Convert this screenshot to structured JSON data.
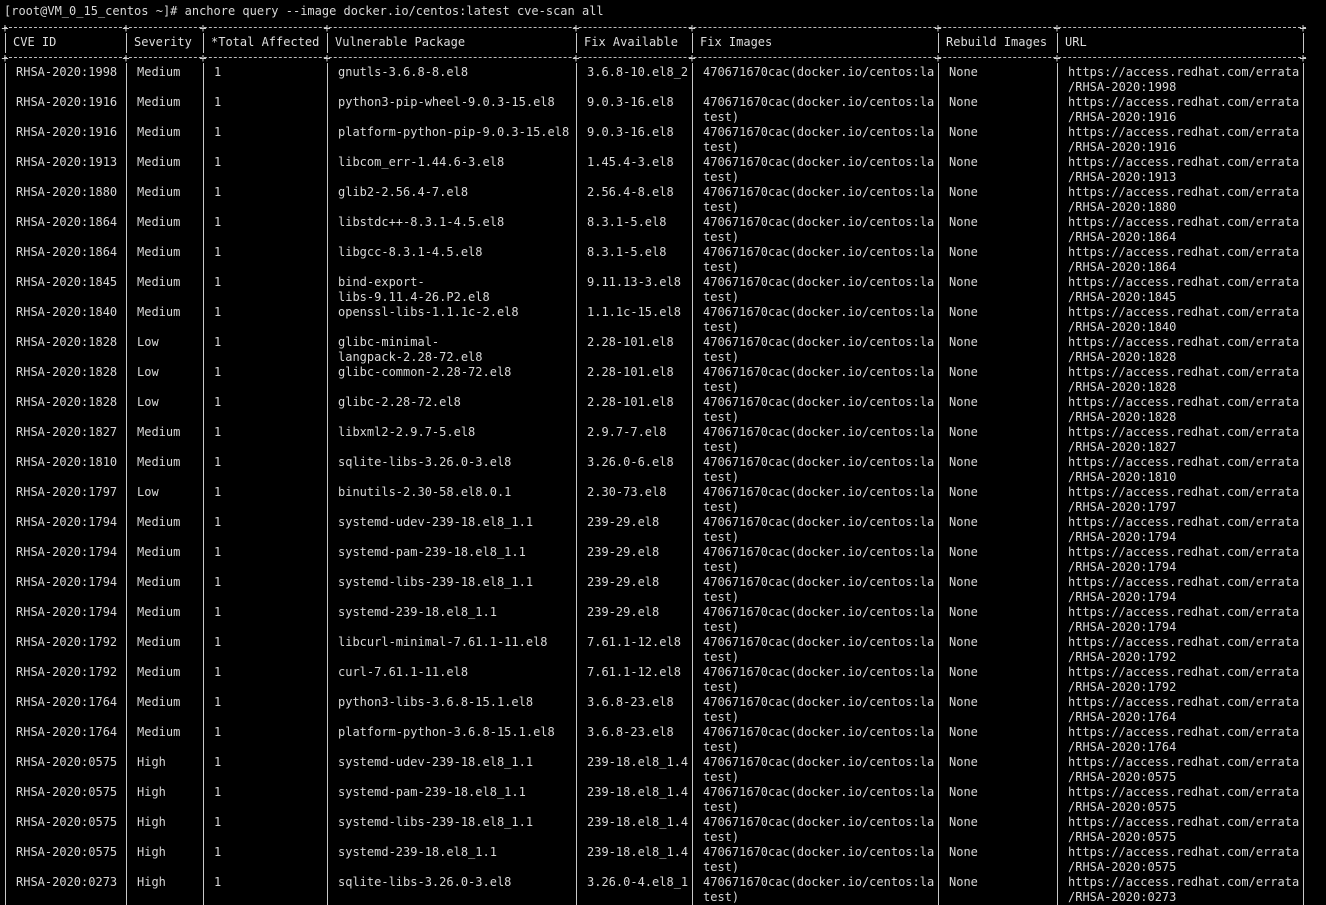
{
  "terminal": {
    "prompt": "[root@VM_0_15_centos ~]# anchore query --image docker.io/centos:latest cve-scan all"
  },
  "table": {
    "columns": [
      "CVE ID",
      "Severity",
      "*Total Affected",
      "Vulnerable Package",
      "Fix Available",
      "Fix Images",
      "Rebuild Images",
      "URL"
    ],
    "rows": [
      {
        "cve": "RHSA-2020:1998",
        "severity": "Medium",
        "total": "1",
        "package": [
          "gnutls-3.6.8-8.el8"
        ],
        "fix": "3.6.8-10.el8_2",
        "images": [
          "470671670cac(docker.io/centos:la"
        ],
        "rebuild": "None",
        "url": [
          "https://access.redhat.com/errata",
          "/RHSA-2020:1998"
        ]
      },
      {
        "cve": "RHSA-2020:1916",
        "severity": "Medium",
        "total": "1",
        "package": [
          "python3-pip-wheel-9.0.3-15.el8"
        ],
        "fix": "9.0.3-16.el8",
        "images": [
          "470671670cac(docker.io/centos:la",
          "test)"
        ],
        "rebuild": "None",
        "url": [
          "https://access.redhat.com/errata",
          "/RHSA-2020:1916"
        ]
      },
      {
        "cve": "RHSA-2020:1916",
        "severity": "Medium",
        "total": "1",
        "package": [
          "platform-python-pip-9.0.3-15.el8"
        ],
        "fix": "9.0.3-16.el8",
        "images": [
          "470671670cac(docker.io/centos:la",
          "test)"
        ],
        "rebuild": "None",
        "url": [
          "https://access.redhat.com/errata",
          "/RHSA-2020:1916"
        ]
      },
      {
        "cve": "RHSA-2020:1913",
        "severity": "Medium",
        "total": "1",
        "package": [
          "libcom_err-1.44.6-3.el8"
        ],
        "fix": "1.45.4-3.el8",
        "images": [
          "470671670cac(docker.io/centos:la",
          "test)"
        ],
        "rebuild": "None",
        "url": [
          "https://access.redhat.com/errata",
          "/RHSA-2020:1913"
        ]
      },
      {
        "cve": "RHSA-2020:1880",
        "severity": "Medium",
        "total": "1",
        "package": [
          "glib2-2.56.4-7.el8"
        ],
        "fix": "2.56.4-8.el8",
        "images": [
          "470671670cac(docker.io/centos:la",
          "test)"
        ],
        "rebuild": "None",
        "url": [
          "https://access.redhat.com/errata",
          "/RHSA-2020:1880"
        ]
      },
      {
        "cve": "RHSA-2020:1864",
        "severity": "Medium",
        "total": "1",
        "package": [
          "libstdc++-8.3.1-4.5.el8"
        ],
        "fix": "8.3.1-5.el8",
        "images": [
          "470671670cac(docker.io/centos:la",
          "test)"
        ],
        "rebuild": "None",
        "url": [
          "https://access.redhat.com/errata",
          "/RHSA-2020:1864"
        ]
      },
      {
        "cve": "RHSA-2020:1864",
        "severity": "Medium",
        "total": "1",
        "package": [
          "libgcc-8.3.1-4.5.el8"
        ],
        "fix": "8.3.1-5.el8",
        "images": [
          "470671670cac(docker.io/centos:la",
          "test)"
        ],
        "rebuild": "None",
        "url": [
          "https://access.redhat.com/errata",
          "/RHSA-2020:1864"
        ]
      },
      {
        "cve": "RHSA-2020:1845",
        "severity": "Medium",
        "total": "1",
        "package": [
          "bind-export-",
          "libs-9.11.4-26.P2.el8"
        ],
        "fix": "9.11.13-3.el8",
        "images": [
          "470671670cac(docker.io/centos:la",
          "test)"
        ],
        "rebuild": "None",
        "url": [
          "https://access.redhat.com/errata",
          "/RHSA-2020:1845"
        ]
      },
      {
        "cve": "RHSA-2020:1840",
        "severity": "Medium",
        "total": "1",
        "package": [
          "openssl-libs-1.1.1c-2.el8"
        ],
        "fix": "1.1.1c-15.el8",
        "images": [
          "470671670cac(docker.io/centos:la",
          "test)"
        ],
        "rebuild": "None",
        "url": [
          "https://access.redhat.com/errata",
          "/RHSA-2020:1840"
        ]
      },
      {
        "cve": "RHSA-2020:1828",
        "severity": "Low",
        "total": "1",
        "package": [
          "glibc-minimal-",
          "langpack-2.28-72.el8"
        ],
        "fix": "2.28-101.el8",
        "images": [
          "470671670cac(docker.io/centos:la",
          "test)"
        ],
        "rebuild": "None",
        "url": [
          "https://access.redhat.com/errata",
          "/RHSA-2020:1828"
        ]
      },
      {
        "cve": "RHSA-2020:1828",
        "severity": "Low",
        "total": "1",
        "package": [
          "glibc-common-2.28-72.el8"
        ],
        "fix": "2.28-101.el8",
        "images": [
          "470671670cac(docker.io/centos:la",
          "test)"
        ],
        "rebuild": "None",
        "url": [
          "https://access.redhat.com/errata",
          "/RHSA-2020:1828"
        ]
      },
      {
        "cve": "RHSA-2020:1828",
        "severity": "Low",
        "total": "1",
        "package": [
          "glibc-2.28-72.el8"
        ],
        "fix": "2.28-101.el8",
        "images": [
          "470671670cac(docker.io/centos:la",
          "test)"
        ],
        "rebuild": "None",
        "url": [
          "https://access.redhat.com/errata",
          "/RHSA-2020:1828"
        ]
      },
      {
        "cve": "RHSA-2020:1827",
        "severity": "Medium",
        "total": "1",
        "package": [
          "libxml2-2.9.7-5.el8"
        ],
        "fix": "2.9.7-7.el8",
        "images": [
          "470671670cac(docker.io/centos:la",
          "test)"
        ],
        "rebuild": "None",
        "url": [
          "https://access.redhat.com/errata",
          "/RHSA-2020:1827"
        ]
      },
      {
        "cve": "RHSA-2020:1810",
        "severity": "Medium",
        "total": "1",
        "package": [
          "sqlite-libs-3.26.0-3.el8"
        ],
        "fix": "3.26.0-6.el8",
        "images": [
          "470671670cac(docker.io/centos:la",
          "test)"
        ],
        "rebuild": "None",
        "url": [
          "https://access.redhat.com/errata",
          "/RHSA-2020:1810"
        ]
      },
      {
        "cve": "RHSA-2020:1797",
        "severity": "Low",
        "total": "1",
        "package": [
          "binutils-2.30-58.el8.0.1"
        ],
        "fix": "2.30-73.el8",
        "images": [
          "470671670cac(docker.io/centos:la",
          "test)"
        ],
        "rebuild": "None",
        "url": [
          "https://access.redhat.com/errata",
          "/RHSA-2020:1797"
        ]
      },
      {
        "cve": "RHSA-2020:1794",
        "severity": "Medium",
        "total": "1",
        "package": [
          "systemd-udev-239-18.el8_1.1"
        ],
        "fix": "239-29.el8",
        "images": [
          "470671670cac(docker.io/centos:la",
          "test)"
        ],
        "rebuild": "None",
        "url": [
          "https://access.redhat.com/errata",
          "/RHSA-2020:1794"
        ]
      },
      {
        "cve": "RHSA-2020:1794",
        "severity": "Medium",
        "total": "1",
        "package": [
          "systemd-pam-239-18.el8_1.1"
        ],
        "fix": "239-29.el8",
        "images": [
          "470671670cac(docker.io/centos:la",
          "test)"
        ],
        "rebuild": "None",
        "url": [
          "https://access.redhat.com/errata",
          "/RHSA-2020:1794"
        ]
      },
      {
        "cve": "RHSA-2020:1794",
        "severity": "Medium",
        "total": "1",
        "package": [
          "systemd-libs-239-18.el8_1.1"
        ],
        "fix": "239-29.el8",
        "images": [
          "470671670cac(docker.io/centos:la",
          "test)"
        ],
        "rebuild": "None",
        "url": [
          "https://access.redhat.com/errata",
          "/RHSA-2020:1794"
        ]
      },
      {
        "cve": "RHSA-2020:1794",
        "severity": "Medium",
        "total": "1",
        "package": [
          "systemd-239-18.el8_1.1"
        ],
        "fix": "239-29.el8",
        "images": [
          "470671670cac(docker.io/centos:la",
          "test)"
        ],
        "rebuild": "None",
        "url": [
          "https://access.redhat.com/errata",
          "/RHSA-2020:1794"
        ]
      },
      {
        "cve": "RHSA-2020:1792",
        "severity": "Medium",
        "total": "1",
        "package": [
          "libcurl-minimal-7.61.1-11.el8"
        ],
        "fix": "7.61.1-12.el8",
        "images": [
          "470671670cac(docker.io/centos:la",
          "test)"
        ],
        "rebuild": "None",
        "url": [
          "https://access.redhat.com/errata",
          "/RHSA-2020:1792"
        ]
      },
      {
        "cve": "RHSA-2020:1792",
        "severity": "Medium",
        "total": "1",
        "package": [
          "curl-7.61.1-11.el8"
        ],
        "fix": "7.61.1-12.el8",
        "images": [
          "470671670cac(docker.io/centos:la",
          "test)"
        ],
        "rebuild": "None",
        "url": [
          "https://access.redhat.com/errata",
          "/RHSA-2020:1792"
        ]
      },
      {
        "cve": "RHSA-2020:1764",
        "severity": "Medium",
        "total": "1",
        "package": [
          "python3-libs-3.6.8-15.1.el8"
        ],
        "fix": "3.6.8-23.el8",
        "images": [
          "470671670cac(docker.io/centos:la",
          "test)"
        ],
        "rebuild": "None",
        "url": [
          "https://access.redhat.com/errata",
          "/RHSA-2020:1764"
        ]
      },
      {
        "cve": "RHSA-2020:1764",
        "severity": "Medium",
        "total": "1",
        "package": [
          "platform-python-3.6.8-15.1.el8"
        ],
        "fix": "3.6.8-23.el8",
        "images": [
          "470671670cac(docker.io/centos:la",
          "test)"
        ],
        "rebuild": "None",
        "url": [
          "https://access.redhat.com/errata",
          "/RHSA-2020:1764"
        ]
      },
      {
        "cve": "RHSA-2020:0575",
        "severity": "High",
        "total": "1",
        "package": [
          "systemd-udev-239-18.el8_1.1"
        ],
        "fix": "239-18.el8_1.4",
        "images": [
          "470671670cac(docker.io/centos:la",
          "test)"
        ],
        "rebuild": "None",
        "url": [
          "https://access.redhat.com/errata",
          "/RHSA-2020:0575"
        ]
      },
      {
        "cve": "RHSA-2020:0575",
        "severity": "High",
        "total": "1",
        "package": [
          "systemd-pam-239-18.el8_1.1"
        ],
        "fix": "239-18.el8_1.4",
        "images": [
          "470671670cac(docker.io/centos:la",
          "test)"
        ],
        "rebuild": "None",
        "url": [
          "https://access.redhat.com/errata",
          "/RHSA-2020:0575"
        ]
      },
      {
        "cve": "RHSA-2020:0575",
        "severity": "High",
        "total": "1",
        "package": [
          "systemd-libs-239-18.el8_1.1"
        ],
        "fix": "239-18.el8_1.4",
        "images": [
          "470671670cac(docker.io/centos:la",
          "test)"
        ],
        "rebuild": "None",
        "url": [
          "https://access.redhat.com/errata",
          "/RHSA-2020:0575"
        ]
      },
      {
        "cve": "RHSA-2020:0575",
        "severity": "High",
        "total": "1",
        "package": [
          "systemd-239-18.el8_1.1"
        ],
        "fix": "239-18.el8_1.4",
        "images": [
          "470671670cac(docker.io/centos:la",
          "test)"
        ],
        "rebuild": "None",
        "url": [
          "https://access.redhat.com/errata",
          "/RHSA-2020:0575"
        ]
      },
      {
        "cve": "RHSA-2020:0273",
        "severity": "High",
        "total": "1",
        "package": [
          "sqlite-libs-3.26.0-3.el8"
        ],
        "fix": "3.26.0-4.el8_1",
        "images": [
          "470671670cac(docker.io/centos:la",
          "test)"
        ],
        "rebuild": "None",
        "url": [
          "https://access.redhat.com/errata",
          "/RHSA-2020:0273"
        ]
      }
    ]
  },
  "colors": {
    "background": "#000000",
    "text": "#d8d8d8",
    "border": "#c8c8c8"
  }
}
